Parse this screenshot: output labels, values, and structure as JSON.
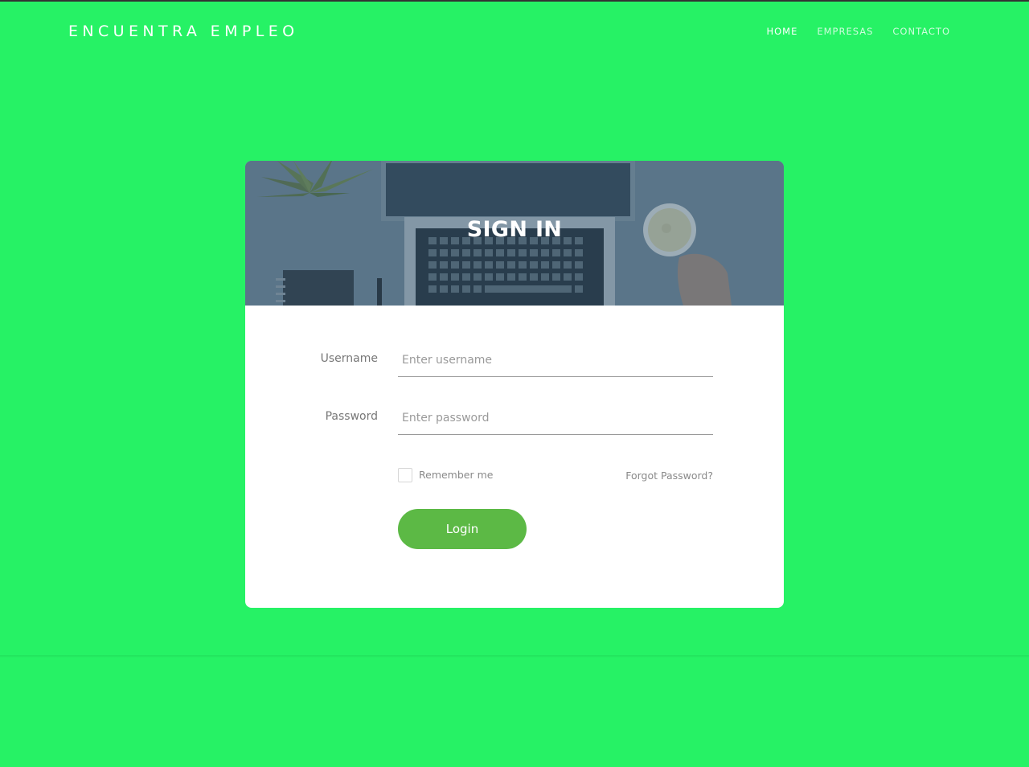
{
  "brand": "ENCUENTRA EMPLEO",
  "nav": {
    "home": "HOME",
    "empresas": "EMPRESAS",
    "contacto": "CONTACTO"
  },
  "card": {
    "title": "SIGN IN"
  },
  "form": {
    "username_label": "Username",
    "username_placeholder": "Enter username",
    "password_label": "Password",
    "password_placeholder": "Enter password",
    "remember_label": "Remember me",
    "forgot_label": "Forgot Password?",
    "login_label": "Login"
  },
  "colors": {
    "page_background": "#26f265",
    "login_button": "#5cb945",
    "header_overlay": "#5c7587"
  }
}
